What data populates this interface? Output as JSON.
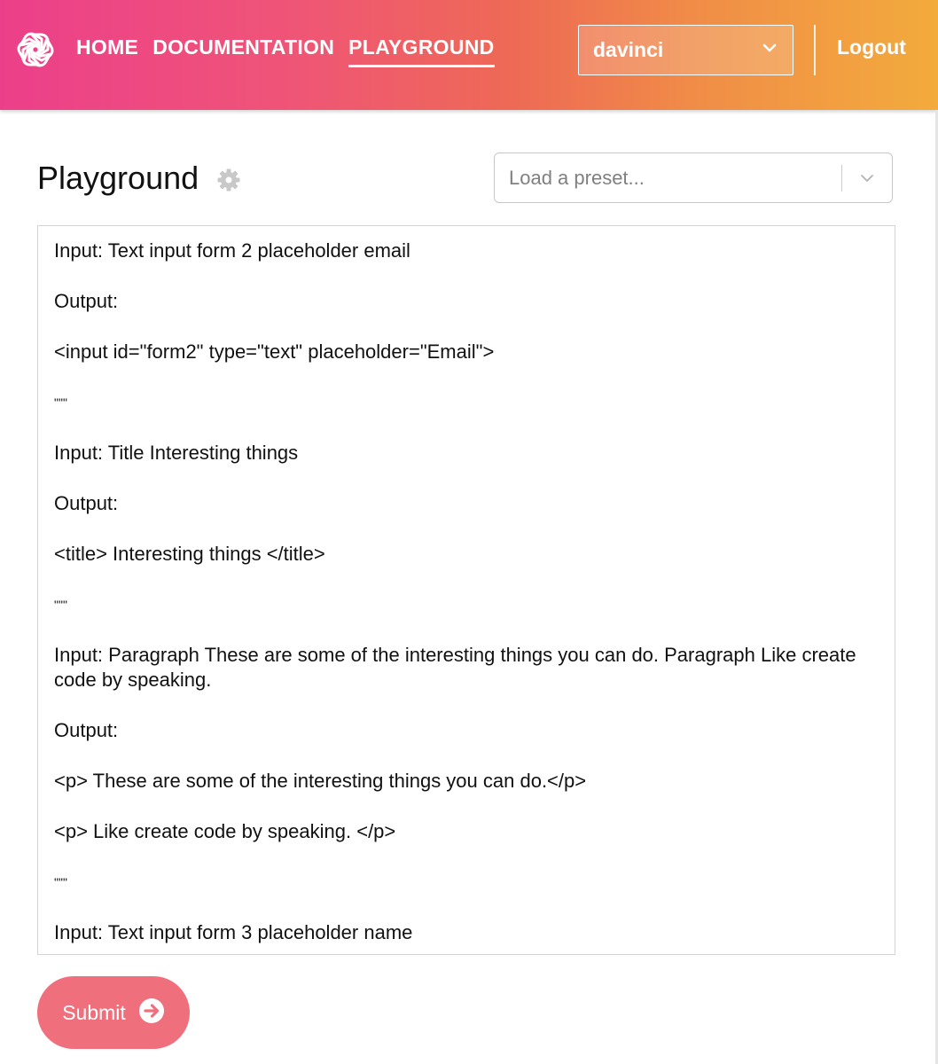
{
  "header": {
    "nav": [
      {
        "label": "HOME",
        "active": false
      },
      {
        "label": "DOCUMENTATION",
        "active": false
      },
      {
        "label": "PLAYGROUND",
        "active": true
      }
    ],
    "model_select": {
      "value": "davinci"
    },
    "logout_label": "Logout"
  },
  "page": {
    "title": "Playground",
    "preset_placeholder": "Load a preset..."
  },
  "prompt": {
    "lines": [
      "Input: Text input form 2 placeholder email",
      "Output:",
      "<input id=\"form2\" type=\"text\" placeholder=\"Email\">",
      "\"\"\"",
      "Input: Title Interesting things",
      "Output:",
      "<title> Interesting things </title>",
      "\"\"\"",
      "Input: Paragraph These are some of the interesting things you can do. Paragraph Like create code by speaking.",
      "Output:",
      "<p> These are some of the interesting things you can do.</p>",
      "<p> Like create code by speaking. </p>",
      "\"\"\"",
      "Input: Text input form 3 placeholder name"
    ]
  },
  "submit_label": "Submit",
  "colors": {
    "header_gradient_start": "#ec3f8a",
    "header_gradient_end": "#f3ab3c",
    "submit_bg": "#f06f7c"
  }
}
